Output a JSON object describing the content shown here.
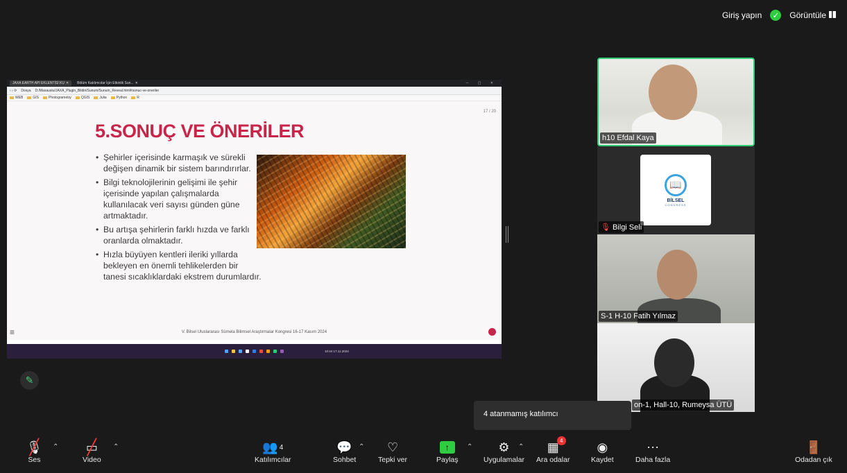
{
  "topbar": {
    "sign_in": "Giriş yapın",
    "view": "Görüntüle"
  },
  "browser": {
    "tab1": "JAXA EARTH API EKLENTİSİ KU",
    "tab2": "Bölüm Katılımcılar İçin Etkinlik Sun...",
    "url_label": "Dosya",
    "url": "D:/Masaustu/JAXA_Plugin_Bildiri/Sunum/Sunum_Reveal.html#sonuc-ve-oneriler",
    "bookmarks": [
      "WEB",
      "GIS",
      "Photogrametry",
      "QGIS",
      "Julia",
      "Python",
      "R"
    ]
  },
  "slide": {
    "page": "17 / 20",
    "title": "5.SONUÇ VE ÖNERİLER",
    "bullets": [
      "Şehirler içerisinde karmaşık ve sürekli değişen dinamik bir sistem barındırırlar.",
      "Bilgi teknolojilerinin gelişimi ile şehir içerisinde yapılan çalışmalarda kullanılacak veri sayısı günden güne artmaktadır.",
      "Bu artışa şehirlerin farklı hızda ve farklı oranlarda olmaktadır.",
      "Hızla büyüyen kentleri ileriki yıllarda bekleyen en önemli tehlikelerden bir tanesi sıcaklıklardaki ekstrem durumlardır."
    ],
    "footer": "V. Bilsel Uluslararası Sümela Bilimsel Araştırmalar Kongresi 16-17 Kasım 2024"
  },
  "taskbar": {
    "time": "10:44",
    "date": "17.11.2024"
  },
  "participants": [
    {
      "name": "h10 Efdal Kaya"
    },
    {
      "name": "Bilgi Seli",
      "logo_text": "BİLSEL",
      "logo_sub": "CONGRESS"
    },
    {
      "name": "S-1 H-10 Fatih Yılmaz"
    },
    {
      "name": "on-1, Hall-10, Rumeysa ÜTÜ"
    }
  ],
  "tooltip": "4 atanmamış katılımcı",
  "toolbar": {
    "audio": "Ses",
    "video": "Video",
    "participants": "Katılımcılar",
    "participants_count": "4",
    "chat": "Sohbet",
    "react": "Tepki ver",
    "share": "Paylaş",
    "apps": "Uygulamalar",
    "breakout": "Ara odalar",
    "breakout_badge": "4",
    "record": "Kaydet",
    "more": "Daha fazla",
    "leave": "Odadan çık"
  },
  "colors": {
    "accent_green": "#2ecc40",
    "slide_title": "#c8254a",
    "badge": "#e33333"
  }
}
